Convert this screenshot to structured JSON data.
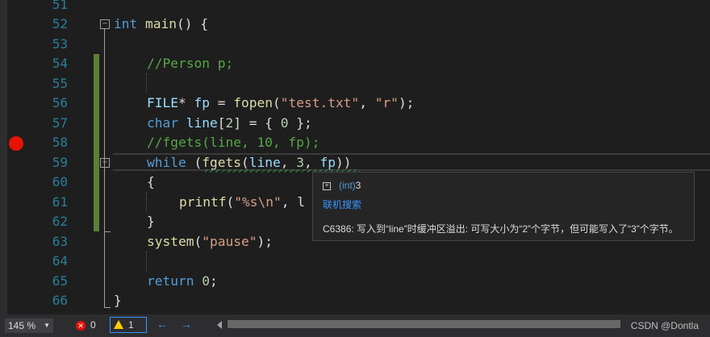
{
  "lines": [
    {
      "num": "51",
      "code": ""
    },
    {
      "num": "52",
      "code": ""
    },
    {
      "num": "53",
      "code": ""
    },
    {
      "num": "54",
      "code": ""
    },
    {
      "num": "55",
      "code": ""
    },
    {
      "num": "56",
      "code": ""
    },
    {
      "num": "57",
      "code": ""
    },
    {
      "num": "58",
      "code": ""
    },
    {
      "num": "59",
      "code": ""
    },
    {
      "num": "60",
      "code": ""
    },
    {
      "num": "61",
      "code": ""
    },
    {
      "num": "62",
      "code": ""
    },
    {
      "num": "63",
      "code": ""
    },
    {
      "num": "64",
      "code": ""
    },
    {
      "num": "65",
      "code": ""
    },
    {
      "num": "66",
      "code": ""
    }
  ],
  "code": {
    "l52_kw": "int",
    "l52_fn": "main",
    "l52_rest": "() {",
    "l54": "//Person p;",
    "l56_type": "FILE",
    "l56_a": "* ",
    "l56_var": "fp",
    "l56_b": " = ",
    "l56_fn": "fopen",
    "l56_c": "(",
    "l56_s1": "\"test.txt\"",
    "l56_d": ", ",
    "l56_s2": "\"r\"",
    "l56_e": ");",
    "l57_kw": "char",
    "l57_a": " ",
    "l57_var": "line",
    "l57_b": "[",
    "l57_n1": "2",
    "l57_c": "] = { ",
    "l57_n2": "0",
    "l57_d": " };",
    "l58": "//fgets(line, 10, fp);",
    "l59_kw": "while",
    "l59_a": " (",
    "l59_fn": "fgets",
    "l59_b": "(",
    "l59_var": "line",
    "l59_c": ", ",
    "l59_n": "3",
    "l59_d": ", ",
    "l59_var2": "fp",
    "l59_e": "))",
    "l60": "{",
    "l61_fn": "printf",
    "l61_a": "(",
    "l61_s": "\"%s\\n\"",
    "l61_b": ", l",
    "l62": "}",
    "l63_fn": "system",
    "l63_a": "(",
    "l63_s": "\"pause\"",
    "l63_b": ");",
    "l65_kw": "return",
    "l65_a": " ",
    "l65_n": "0",
    "l65_b": ";",
    "l66": "}"
  },
  "tooltip": {
    "type_kw": "(int)",
    "type_val": "3",
    "link": "联机搜索",
    "message": "C6386: 写入到“line”时缓冲区溢出: 可写大小为“2”个字节，但可能写入了“3”个字节。"
  },
  "status": {
    "zoom": "145 %",
    "errors": "0",
    "warnings": "1",
    "credit": "CSDN @Dontla"
  },
  "colors": {
    "background": "#1e1e1e",
    "breakpoint": "#e51400",
    "change_bar": "#5c7e37",
    "link": "#3794ff"
  }
}
